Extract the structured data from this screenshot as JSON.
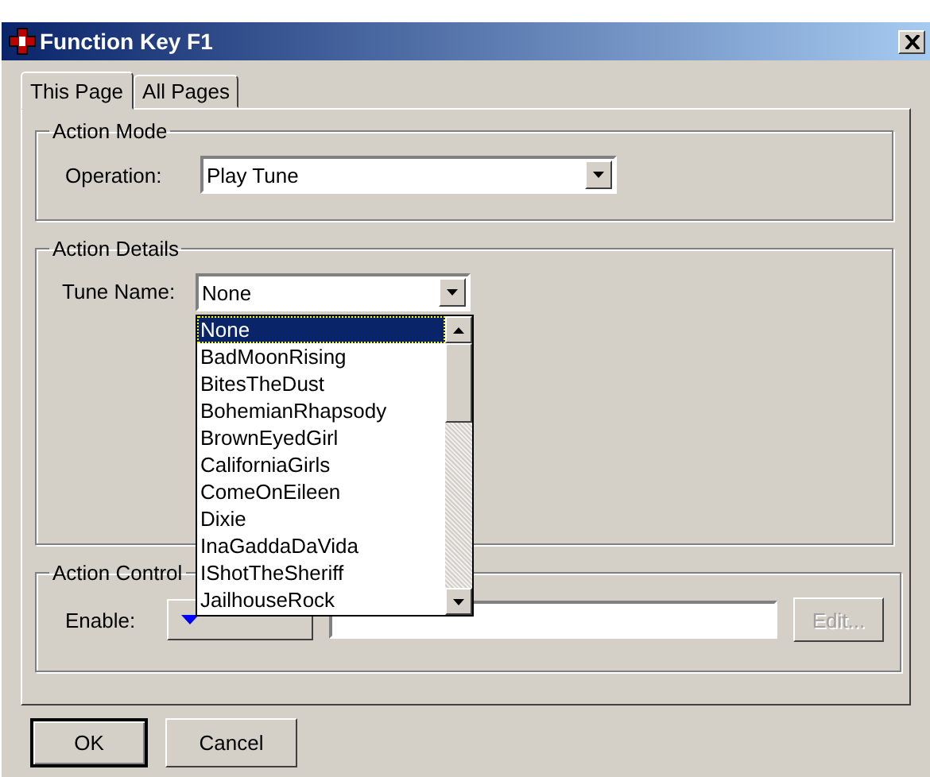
{
  "window": {
    "title": "Function Key F1"
  },
  "tabs": [
    {
      "label": "This Page",
      "selected": true
    },
    {
      "label": "All Pages",
      "selected": false
    }
  ],
  "action_mode": {
    "title": "Action Mode",
    "operation": {
      "label": "Operation:",
      "value": "Play Tune"
    }
  },
  "action_details": {
    "title": "Action Details",
    "tune_name": {
      "label": "Tune Name:",
      "value": "None",
      "expanded": true,
      "options": [
        {
          "label": "None",
          "selected": true
        },
        {
          "label": "BadMoonRising",
          "selected": false
        },
        {
          "label": "BitesTheDust",
          "selected": false
        },
        {
          "label": "BohemianRhapsody",
          "selected": false
        },
        {
          "label": "BrownEyedGirl",
          "selected": false
        },
        {
          "label": "CaliforniaGirls",
          "selected": false
        },
        {
          "label": "ComeOnEileen",
          "selected": false
        },
        {
          "label": "Dixie",
          "selected": false
        },
        {
          "label": "InaGaddaDaVida",
          "selected": false
        },
        {
          "label": "IShotTheSheriff",
          "selected": false
        },
        {
          "label": "JailhouseRock",
          "selected": false
        }
      ]
    }
  },
  "action_control": {
    "title": "Action Control",
    "enable": {
      "label": "Enable:",
      "edit_button": {
        "label": "Edit...",
        "disabled": true
      }
    }
  },
  "buttons": [
    {
      "label": "OK",
      "default": true
    },
    {
      "label": "Cancel",
      "default": false
    }
  ]
}
